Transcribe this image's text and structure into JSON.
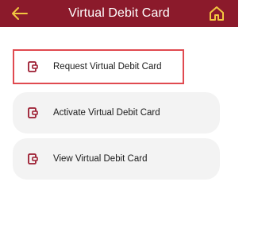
{
  "header": {
    "title": "Virtual Debit Card",
    "background_color": "#8b1a2b",
    "accent_color": "#f2c640",
    "back_icon": "arrow-left-icon",
    "home_icon": "home-icon"
  },
  "menu": {
    "items": [
      {
        "label": "Request Virtual Debit Card",
        "icon": "card-icon",
        "highlighted": true
      },
      {
        "label": "Activate Virtual Debit Card",
        "icon": "card-icon",
        "highlighted": false
      },
      {
        "label": "View Virtual Debit Card",
        "icon": "card-icon",
        "highlighted": false
      }
    ],
    "icon_color": "#9c1c30",
    "highlight_color": "#e04a50"
  }
}
